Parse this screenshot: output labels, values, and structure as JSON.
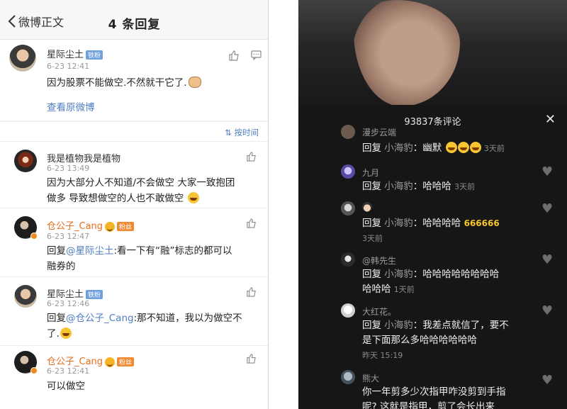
{
  "weibo": {
    "back_label": "微博正文",
    "title": "4 条回复",
    "main_comment": {
      "user": "星际尘土",
      "badge": "铁粉",
      "time": "6-23 12:41",
      "text": "因为股票不能做空.不然就干它了.",
      "view_original": "查看原微博"
    },
    "sort_label": "按时间",
    "replies": [
      {
        "user": "我是植物我是植物",
        "time": "6-23 13:49",
        "line1": "因为大部分人不知道/不会做空 大家一致抱团",
        "line2": "做多 导致想做空的人也不敢做空"
      },
      {
        "user": "仓公子_Cang",
        "badge": "粉丝",
        "time": "6-23 12:47",
        "reply_prefix": "回复",
        "mention": "@星际尘土",
        "line1_rest": ":看一下有“融”标志的都可以",
        "line2": "融券的"
      },
      {
        "user": "星际尘土",
        "badge": "铁粉",
        "time": "6-23 12:46",
        "reply_prefix": "回复",
        "mention": "@仓公子_Cang",
        "line1_rest": ":那不知道，我以为做空不",
        "line2": "了."
      },
      {
        "user": "仓公子_Cang",
        "badge": "粉丝",
        "time": "6-23 12:41",
        "line1": "可以做空"
      }
    ],
    "colors": {
      "link": "#4f7ec2",
      "vip_name": "#e66e1a"
    }
  },
  "douyin": {
    "panel_title": "93837条评论",
    "close_icon": "close-icon",
    "comments": [
      {
        "name": "漫步云端",
        "reply": "回复",
        "mention": "小海豹",
        "body": "：幽默",
        "time": "3天前"
      },
      {
        "name": "九月",
        "reply": "回复",
        "mention": "小海豹",
        "body": "：哈哈哈",
        "time": "3天前"
      },
      {
        "name": "",
        "reply": "回复",
        "mention": "小海豹",
        "body": "：哈哈哈哈",
        "time": "3天前"
      },
      {
        "name": "@韩先生",
        "reply": "回复",
        "mention": "小海豹",
        "body": "：哈哈哈哈哈哈哈哈",
        "line2": "哈哈哈",
        "time": "1天前"
      },
      {
        "name": "大红花。",
        "reply": "回复",
        "mention": "小海豹",
        "body": "：我差点就信了，要不",
        "line2": "是下面那么多哈哈哈哈哈哈",
        "time": "昨天 15:19"
      },
      {
        "name": "熊大",
        "line1": "你一年剪多少次指甲咋没剪到手指",
        "line2": "呢? 这就是指甲，剪了会长出来"
      }
    ],
    "emoji_66": "666"
  }
}
